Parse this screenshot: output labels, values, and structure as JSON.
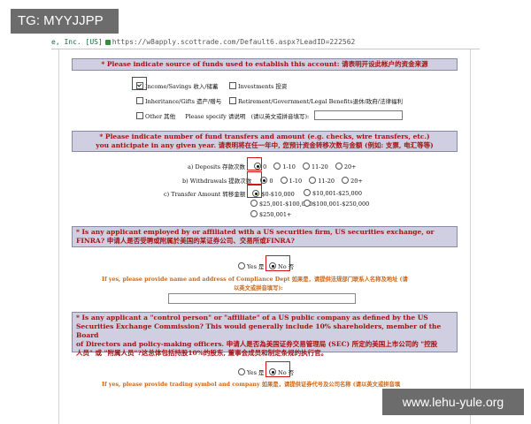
{
  "tag": "TG: MYYJJPP",
  "watermark": "www.lehu-yule.org",
  "urlbar": {
    "site": "e, Inc. [US]",
    "url": "https://w8apply.scottrade.com/Default6.aspx?LeadID=222562"
  },
  "funds": {
    "heading": "* Please indicate source of funds used to establish this account: 请表明开设此帐户的资金来源",
    "options": [
      {
        "label": "Income/Savings 收入/储蓄",
        "checked": true
      },
      {
        "label": "Investments 投资",
        "checked": false
      },
      {
        "label": "Inheritance/Gifts 遗产/赠与",
        "checked": false
      },
      {
        "label": "Retirement/Government/Legal Benefits退休/政府/法律福利",
        "checked": false
      },
      {
        "label": "Other 其他",
        "checked": false
      }
    ],
    "specify_label": "Please specify 请说明",
    "specify_hint": "(请以英文或拼音填写):"
  },
  "transfers": {
    "heading_line1": "* Please indicate number of fund transfers and amount (e.g. checks, wire transfers, etc.)",
    "heading_line2": "you anticipate in any given year. 请表明将在任一年中, 您预计资金转移次数与金额 (例如: 支票, 电汇等等)",
    "deposits_label": "a) Deposits 存款次数",
    "withdrawals_label": "b) Withdrawals 提款次数",
    "count_options": [
      "0",
      "1-10",
      "11-20",
      "20+"
    ],
    "transfer_label": "c) Transfer Amount 转移金额",
    "amount_options": [
      "$0-$10,000",
      "$10,001-$25,000",
      "$25,001-$100,000",
      "$100,001-$250,000",
      "$250,001+"
    ]
  },
  "employed": {
    "heading_line1": "* Is any applicant employed by or affiliated with a US securities firm, US securities exchange, or",
    "heading_line2": "FINRA? 申请人是否受聘或附属於美国的某证券公司、交易所或FINRA?",
    "yes": "Yes 是",
    "no": "No 否",
    "note_line1": "If yes, please provide name and address of Compliance Dept 如果是，请提供法规部门联系人名称及地址 (请",
    "note_line2": "以英文或拼音填写):"
  },
  "control": {
    "heading_line1": "* Is any applicant a \"control person\" or \"affiliate\" of a US public company as defined by the US",
    "heading_line2": "Securities Exchange Commission? This would generally include 10% shareholders, member of the Board",
    "heading_line3": "of Directors and policy-making officers. 申请人是否為美国证券交易管理局 (SEC) 所定的美国上市公司的 \"控股",
    "heading_line4": "人员\" 或 \"附属人员\"?这总体包括持股10%的股东, 董事会成员和制定条规的执行官。",
    "yes": "Yes 是",
    "no": "No 否",
    "note": "If yes, please provide trading symbol and company 如果是，请提供证券代号及公司名称 (请以英文或拼音填"
  }
}
